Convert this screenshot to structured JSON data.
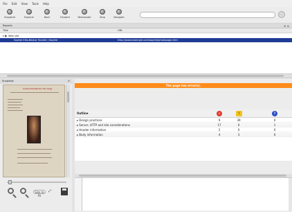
{
  "menu": [
    "File",
    "Edit",
    "View",
    "Tools",
    "Help"
  ],
  "toolbar": [
    {
      "label": "Snapshot",
      "icon": "camera-icon"
    },
    {
      "label": "Explorer",
      "icon": "globe-icon"
    },
    {
      "label": "Back",
      "icon": "back-arrow-icon"
    },
    {
      "label": "Forward",
      "icon": "forward-arrow-icon"
    },
    {
      "label": "Reevaluate",
      "icon": "refresh-icon"
    },
    {
      "label": "Stop",
      "icon": "stop-icon"
    },
    {
      "label": "Navigate",
      "icon": "navigate-icon"
    }
  ],
  "reports": {
    "title": "Reports",
    "columns": [
      "Title",
      "URL"
    ],
    "rows": [
      {
        "title": "Web site",
        "url": ""
      },
      {
        "title": "Sophie Ellis-Bextor Fansite | Sophie",
        "url": "http://www.example.com/sophie/photopage.htm"
      }
    ]
  },
  "snapshot": {
    "title": "Snapshot",
    "page_title": "Sophie Ellis-Bextor Fan Page",
    "zoom_label": "Size to fit"
  },
  "issue_banner": "The page has error(s).",
  "outline": {
    "label": "Outline",
    "rows": [
      {
        "name": "Design practices",
        "errors": "9",
        "warnings": "39",
        "info": "0"
      },
      {
        "name": "Server, HTTP and site considerations",
        "errors": "17",
        "warnings": "0",
        "info": "1"
      },
      {
        "name": "Header information",
        "errors": "2",
        "warnings": "0",
        "info": "0"
      },
      {
        "name": "Body information",
        "errors": "4",
        "warnings": "3",
        "info": "0"
      }
    ]
  },
  "colors": {
    "banner": "#ff8c1a",
    "selection": "#1f3c96",
    "error": "#e03a2a",
    "warning": "#f1c21b",
    "info": "#2c50c8"
  }
}
